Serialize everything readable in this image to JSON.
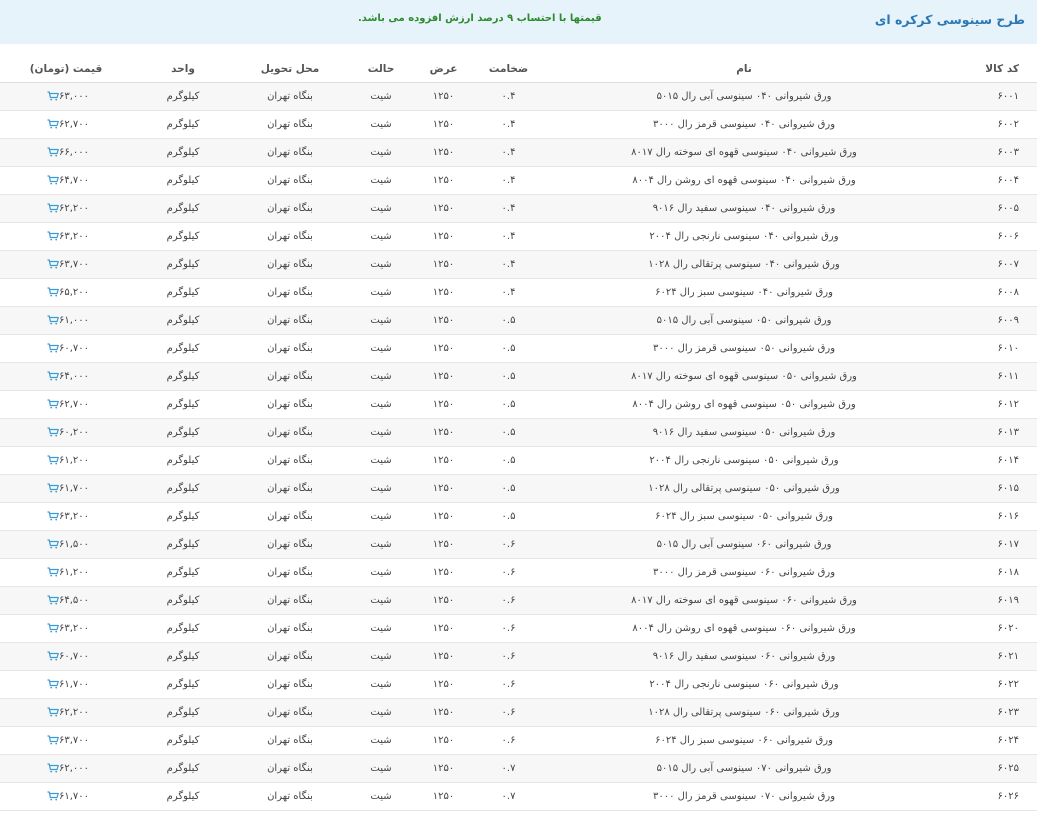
{
  "header": {
    "title": "طرح سینوسی کرکره ای",
    "note": "قیمتها با احتساب ۹ درصد ارزش افزوده می باشد."
  },
  "columns": {
    "code": "کد کالا",
    "name": "نام",
    "thickness": "ضخامت",
    "width": "عرض",
    "state": "حالت",
    "delivery": "محل تحویل",
    "unit": "واحد",
    "price": "قیمت (تومان)"
  },
  "icons": {
    "cart": "cart-icon"
  },
  "colors": {
    "title": "#2b78b5",
    "note": "#2c8a2c",
    "banner_bg": "#e7f3fb",
    "cart": "#3a9bd5"
  },
  "rows": [
    {
      "code": "۶۰۰۱",
      "name": "ورق شیروانی ۰۴۰ سینوسی آبی رال ۵۰۱۵",
      "thickness": "۰.۴",
      "width": "۱۲۵۰",
      "state": "شیت",
      "delivery": "بنگاه تهران",
      "unit": "کیلوگرم",
      "price": "۶۳,۰۰۰"
    },
    {
      "code": "۶۰۰۲",
      "name": "ورق شیروانی ۰۴۰ سینوسی قرمز رال ۳۰۰۰",
      "thickness": "۰.۴",
      "width": "۱۲۵۰",
      "state": "شیت",
      "delivery": "بنگاه تهران",
      "unit": "کیلوگرم",
      "price": "۶۲,۷۰۰"
    },
    {
      "code": "۶۰۰۳",
      "name": "ورق شیروانی ۰۴۰ سینوسی قهوه ای سوخته رال ۸۰۱۷",
      "thickness": "۰.۴",
      "width": "۱۲۵۰",
      "state": "شیت",
      "delivery": "بنگاه تهران",
      "unit": "کیلوگرم",
      "price": "۶۶,۰۰۰"
    },
    {
      "code": "۶۰۰۴",
      "name": "ورق شیروانی ۰۴۰ سینوسی قهوه ای روشن رال ۸۰۰۴",
      "thickness": "۰.۴",
      "width": "۱۲۵۰",
      "state": "شیت",
      "delivery": "بنگاه تهران",
      "unit": "کیلوگرم",
      "price": "۶۴,۷۰۰"
    },
    {
      "code": "۶۰۰۵",
      "name": "ورق شیروانی ۰۴۰ سینوسی سفید رال ۹۰۱۶",
      "thickness": "۰.۴",
      "width": "۱۲۵۰",
      "state": "شیت",
      "delivery": "بنگاه تهران",
      "unit": "کیلوگرم",
      "price": "۶۲,۲۰۰"
    },
    {
      "code": "۶۰۰۶",
      "name": "ورق شیروانی ۰۴۰ سینوسی نارنجی رال ۲۰۰۴",
      "thickness": "۰.۴",
      "width": "۱۲۵۰",
      "state": "شیت",
      "delivery": "بنگاه تهران",
      "unit": "کیلوگرم",
      "price": "۶۳,۲۰۰"
    },
    {
      "code": "۶۰۰۷",
      "name": "ورق شیروانی ۰۴۰ سینوسی پرتقالی رال ۱۰۲۸",
      "thickness": "۰.۴",
      "width": "۱۲۵۰",
      "state": "شیت",
      "delivery": "بنگاه تهران",
      "unit": "کیلوگرم",
      "price": "۶۳,۷۰۰"
    },
    {
      "code": "۶۰۰۸",
      "name": "ورق شیروانی ۰۴۰ سینوسی سبز رال ۶۰۲۴",
      "thickness": "۰.۴",
      "width": "۱۲۵۰",
      "state": "شیت",
      "delivery": "بنگاه تهران",
      "unit": "کیلوگرم",
      "price": "۶۵,۲۰۰"
    },
    {
      "code": "۶۰۰۹",
      "name": "ورق شیروانی ۰۵۰ سینوسی آبی رال ۵۰۱۵",
      "thickness": "۰.۵",
      "width": "۱۲۵۰",
      "state": "شیت",
      "delivery": "بنگاه تهران",
      "unit": "کیلوگرم",
      "price": "۶۱,۰۰۰"
    },
    {
      "code": "۶۰۱۰",
      "name": "ورق شیروانی ۰۵۰ سینوسی قرمز رال ۳۰۰۰",
      "thickness": "۰.۵",
      "width": "۱۲۵۰",
      "state": "شیت",
      "delivery": "بنگاه تهران",
      "unit": "کیلوگرم",
      "price": "۶۰,۷۰۰"
    },
    {
      "code": "۶۰۱۱",
      "name": "ورق شیروانی ۰۵۰ سینوسی قهوه ای سوخته رال ۸۰۱۷",
      "thickness": "۰.۵",
      "width": "۱۲۵۰",
      "state": "شیت",
      "delivery": "بنگاه تهران",
      "unit": "کیلوگرم",
      "price": "۶۴,۰۰۰"
    },
    {
      "code": "۶۰۱۲",
      "name": "ورق شیروانی ۰۵۰ سینوسی قهوه ای روشن رال ۸۰۰۴",
      "thickness": "۰.۵",
      "width": "۱۲۵۰",
      "state": "شیت",
      "delivery": "بنگاه تهران",
      "unit": "کیلوگرم",
      "price": "۶۲,۷۰۰"
    },
    {
      "code": "۶۰۱۳",
      "name": "ورق شیروانی ۰۵۰ سینوسی سفید رال ۹۰۱۶",
      "thickness": "۰.۵",
      "width": "۱۲۵۰",
      "state": "شیت",
      "delivery": "بنگاه تهران",
      "unit": "کیلوگرم",
      "price": "۶۰,۲۰۰"
    },
    {
      "code": "۶۰۱۴",
      "name": "ورق شیروانی ۰۵۰ سینوسی نارنجی رال ۲۰۰۴",
      "thickness": "۰.۵",
      "width": "۱۲۵۰",
      "state": "شیت",
      "delivery": "بنگاه تهران",
      "unit": "کیلوگرم",
      "price": "۶۱,۲۰۰"
    },
    {
      "code": "۶۰۱۵",
      "name": "ورق شیروانی ۰۵۰ سینوسی پرتقالی رال ۱۰۲۸",
      "thickness": "۰.۵",
      "width": "۱۲۵۰",
      "state": "شیت",
      "delivery": "بنگاه تهران",
      "unit": "کیلوگرم",
      "price": "۶۱,۷۰۰"
    },
    {
      "code": "۶۰۱۶",
      "name": "ورق شیروانی ۰۵۰ سینوسی سبز رال ۶۰۲۴",
      "thickness": "۰.۵",
      "width": "۱۲۵۰",
      "state": "شیت",
      "delivery": "بنگاه تهران",
      "unit": "کیلوگرم",
      "price": "۶۳,۲۰۰"
    },
    {
      "code": "۶۰۱۷",
      "name": "ورق شیروانی ۰۶۰ سینوسی آبی رال ۵۰۱۵",
      "thickness": "۰.۶",
      "width": "۱۲۵۰",
      "state": "شیت",
      "delivery": "بنگاه تهران",
      "unit": "کیلوگرم",
      "price": "۶۱,۵۰۰"
    },
    {
      "code": "۶۰۱۸",
      "name": "ورق شیروانی ۰۶۰ سینوسی قرمز رال ۳۰۰۰",
      "thickness": "۰.۶",
      "width": "۱۲۵۰",
      "state": "شیت",
      "delivery": "بنگاه تهران",
      "unit": "کیلوگرم",
      "price": "۶۱,۲۰۰"
    },
    {
      "code": "۶۰۱۹",
      "name": "ورق شیروانی ۰۶۰ سینوسی قهوه ای سوخته رال ۸۰۱۷",
      "thickness": "۰.۶",
      "width": "۱۲۵۰",
      "state": "شیت",
      "delivery": "بنگاه تهران",
      "unit": "کیلوگرم",
      "price": "۶۴,۵۰۰"
    },
    {
      "code": "۶۰۲۰",
      "name": "ورق شیروانی ۰۶۰ سینوسی قهوه ای روشن رال ۸۰۰۴",
      "thickness": "۰.۶",
      "width": "۱۲۵۰",
      "state": "شیت",
      "delivery": "بنگاه تهران",
      "unit": "کیلوگرم",
      "price": "۶۳,۲۰۰"
    },
    {
      "code": "۶۰۲۱",
      "name": "ورق شیروانی ۰۶۰ سینوسی سفید رال ۹۰۱۶",
      "thickness": "۰.۶",
      "width": "۱۲۵۰",
      "state": "شیت",
      "delivery": "بنگاه تهران",
      "unit": "کیلوگرم",
      "price": "۶۰,۷۰۰"
    },
    {
      "code": "۶۰۲۲",
      "name": "ورق شیروانی ۰۶۰ سینوسی نارنجی رال ۲۰۰۴",
      "thickness": "۰.۶",
      "width": "۱۲۵۰",
      "state": "شیت",
      "delivery": "بنگاه تهران",
      "unit": "کیلوگرم",
      "price": "۶۱,۷۰۰"
    },
    {
      "code": "۶۰۲۳",
      "name": "ورق شیروانی ۰۶۰ سینوسی پرتقالی رال ۱۰۲۸",
      "thickness": "۰.۶",
      "width": "۱۲۵۰",
      "state": "شیت",
      "delivery": "بنگاه تهران",
      "unit": "کیلوگرم",
      "price": "۶۲,۲۰۰"
    },
    {
      "code": "۶۰۲۴",
      "name": "ورق شیروانی ۰۶۰ سینوسی سبز رال ۶۰۲۴",
      "thickness": "۰.۶",
      "width": "۱۲۵۰",
      "state": "شیت",
      "delivery": "بنگاه تهران",
      "unit": "کیلوگرم",
      "price": "۶۳,۷۰۰"
    },
    {
      "code": "۶۰۲۵",
      "name": "ورق شیروانی ۰۷۰ سینوسی آبی رال ۵۰۱۵",
      "thickness": "۰.۷",
      "width": "۱۲۵۰",
      "state": "شیت",
      "delivery": "بنگاه تهران",
      "unit": "کیلوگرم",
      "price": "۶۲,۰۰۰"
    },
    {
      "code": "۶۰۲۶",
      "name": "ورق شیروانی ۰۷۰ سینوسی قرمز رال ۳۰۰۰",
      "thickness": "۰.۷",
      "width": "۱۲۵۰",
      "state": "شیت",
      "delivery": "بنگاه تهران",
      "unit": "کیلوگرم",
      "price": "۶۱,۷۰۰"
    }
  ]
}
